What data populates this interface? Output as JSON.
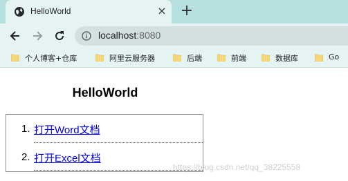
{
  "browser": {
    "tab": {
      "title": "HelloWorld",
      "favicon": "globe-icon",
      "close": "×"
    },
    "new_tab": "+",
    "address": {
      "host": "localhost",
      "port": ":8080"
    }
  },
  "bookmarks": [
    {
      "label": "个人博客+仓库",
      "icon": "folder-icon"
    },
    {
      "label": "阿里云服务器",
      "icon": "folder-icon"
    },
    {
      "label": "后端",
      "icon": "folder-icon"
    },
    {
      "label": "前端",
      "icon": "folder-icon"
    },
    {
      "label": "数据库",
      "icon": "folder-icon"
    },
    {
      "label": "Go",
      "icon": "folder-icon"
    }
  ],
  "page": {
    "title": "HelloWorld",
    "links": [
      {
        "number": "1.",
        "label": "打开Word文档"
      },
      {
        "number": "2.",
        "label": "打开Excel文档"
      }
    ]
  },
  "watermark": "https://blog.csdn.net/qq_38225558",
  "colors": {
    "tabstrip": "#b6e0e0",
    "toolbar": "#e6f3f3",
    "link": "#0000ee"
  }
}
